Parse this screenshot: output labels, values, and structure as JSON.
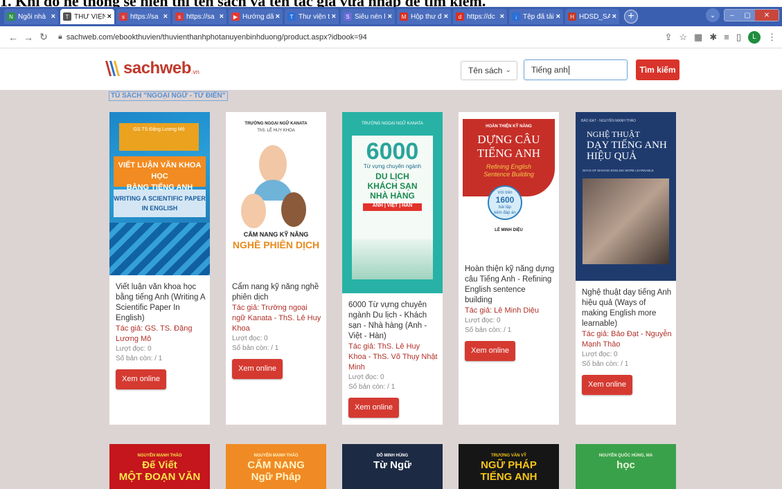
{
  "caption": "1. Khi đó hệ thống sẽ hiển thị tên sách và tên tác giả vừa nhập để tìm kiếm.",
  "browser": {
    "tabs": [
      {
        "label": "Ngôi nhà",
        "color": "#2f8f4a",
        "glyph": "N"
      },
      {
        "label": "THƯ VIỆN",
        "color": "#555555",
        "glyph": "T",
        "active": true
      },
      {
        "label": "https://sa",
        "color": "#d63b3b",
        "glyph": "s"
      },
      {
        "label": "https://sa",
        "color": "#d63b3b",
        "glyph": "s"
      },
      {
        "label": "Hướng dẫ",
        "color": "#e53935",
        "glyph": "▶"
      },
      {
        "label": "Thư viện t",
        "color": "#2c6fd6",
        "glyph": "T"
      },
      {
        "label": "Siêu nén l",
        "color": "#6b6bd6",
        "glyph": "S"
      },
      {
        "label": "Hộp thư đ",
        "color": "#d93025",
        "glyph": "M"
      },
      {
        "label": "https://dc",
        "color": "#d93025",
        "glyph": "d"
      },
      {
        "label": "Tệp đã tải",
        "color": "#2c6fd6",
        "glyph": "↓"
      },
      {
        "label": "HDSD_SA",
        "color": "#c0392b",
        "glyph": "H"
      }
    ],
    "url": "sachweb.com/ebookthuvien/thuvienthanhphotanuyenbinhduong/product.aspx?idbook=94",
    "avatar": "L"
  },
  "header": {
    "logo_text": "sachweb",
    "logo_sub": ".vn",
    "select_value": "Tên sách",
    "search_value": "Tiếng anh",
    "search_button": "Tìm kiếm"
  },
  "section_title": "TỦ SÁCH \"NGOẠI NGỮ - TỪ ĐIỂN\"",
  "labels": {
    "reads": "Lượt đọc: 0",
    "copies": "Số bản còn: / 1",
    "button": "Xem online"
  },
  "books": [
    {
      "title": "Viết luận văn khoa học bằng tiếng Anh (Writing A Scientific Paper In English)",
      "author": "Tác giả: GS. TS. Đặng Lương Mô",
      "cover_lines": [
        "GS.TS Đặng Lương Mô",
        "VIẾT LUẬN VĂN KHOA HỌC",
        "BẰNG TIẾNG ANH",
        "WRITING A SCIENTIFIC PAPER",
        "IN ENGLISH"
      ]
    },
    {
      "title": "Cẩm nang kỹ năng nghề phiên dịch",
      "author": "Tác giả: Trường ngoại ngữ Kanata - ThS. Lê Huy Khoa",
      "cover_lines": [
        "TRƯỜNG NGOẠI NGỮ KANATA",
        "ThS. LÊ HUY KHOA",
        "CẨM NANG KỸ NĂNG",
        "NGHỀ PHIÊN DỊCH"
      ]
    },
    {
      "title": "6000 Từ vựng chuyên ngành Du lịch - Khách sạn - Nhà hàng (Anh - Việt - Hàn)",
      "author": "Tác giả: ThS. Lê Huy Khoa - ThS. Võ Thụy Nhật Minh",
      "cover_lines": [
        "TRƯỜNG NGOẠI NGỮ KANATA",
        "6000",
        "Từ vựng chuyên ngành",
        "DU LỊCH",
        "KHÁCH SẠN",
        "NHÀ HÀNG",
        "ANH | VIỆT | HÀN"
      ]
    },
    {
      "title": "Hoàn thiện kỹ năng dựng câu Tiếng Anh - Refining English sentence building",
      "author": "Tác giả: Lê Minh Diệu",
      "cover_lines": [
        "HOÀN THIỆN KỸ NĂNG",
        "DỰNG CÂU",
        "TIẾNG ANH",
        "Refining English",
        "Sentence Building",
        "Với trên",
        "1600",
        "bài tập",
        "kèm đáp án",
        "LÊ MINH DIỆU"
      ]
    },
    {
      "title": "Nghệ thuật dạy tiếng Anh hiệu quả (Ways of making English more learnable)",
      "author": "Tác giả: Bảo Đạt - Nguyễn Mạnh Thảo",
      "cover_lines": [
        "BẢO ĐẠT - NGUYỄN MẠNH THẢO",
        "NGHỆ THUẬT",
        "DẠY TIẾNG ANH",
        "HIỆU QUẢ",
        "WAYS OF MAKING ENGLISH MORE LEARNABLE"
      ]
    }
  ],
  "next_row": [
    {
      "lines": [
        "NGUYỄN MẠNH THẢO",
        "Đế Viết",
        "MỘT ĐOẠN VĂN"
      ]
    },
    {
      "lines": [
        "NGUYỄN MẠNH THẢO",
        "CẨM NANG",
        "Ngữ Pháp"
      ]
    },
    {
      "lines": [
        "ĐỖ MINH HÙNG",
        "Từ Ngữ"
      ]
    },
    {
      "lines": [
        "TRƯƠNG VĂN VỸ",
        "NGỮ PHÁP",
        "TIẾNG ANH"
      ]
    },
    {
      "lines": [
        "NGUYỄN QUỐC HÙNG, MA",
        "học"
      ]
    }
  ]
}
